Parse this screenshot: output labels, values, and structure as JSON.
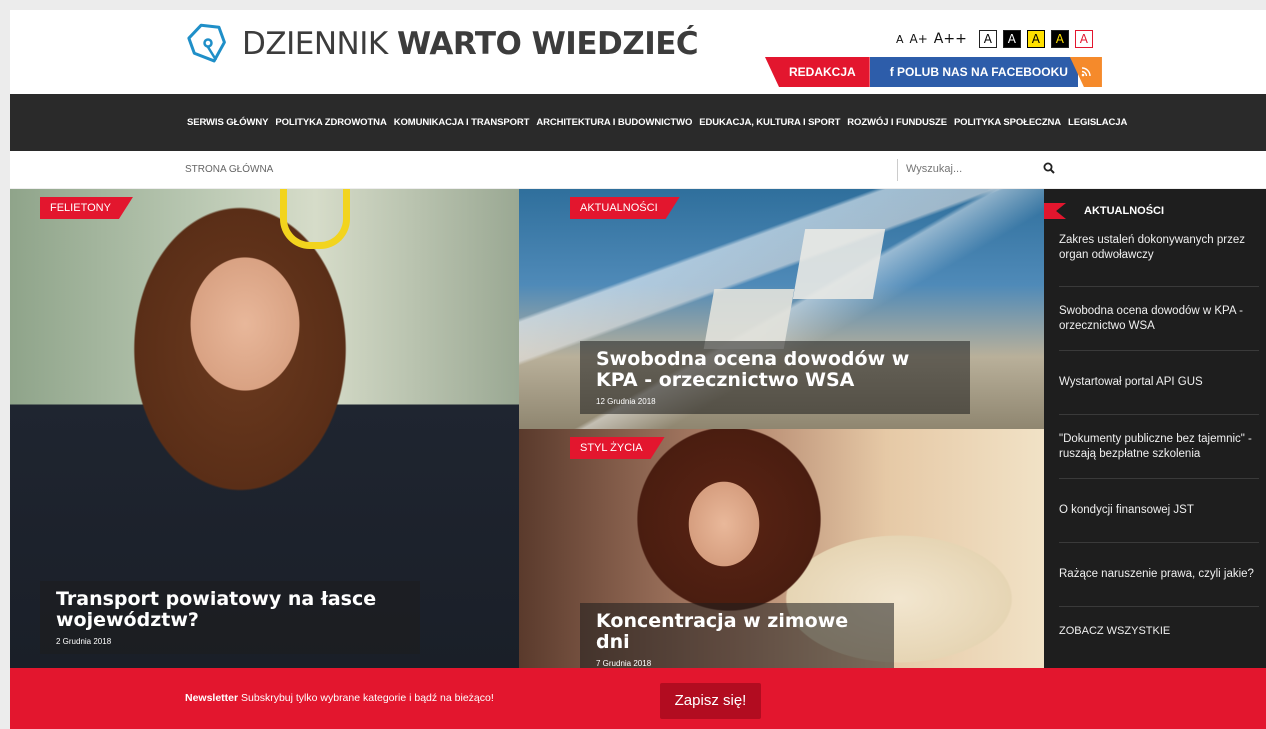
{
  "header": {
    "logo_light": "DZIENNIK ",
    "logo_bold": "WARTO WIEDZIEĆ",
    "font_sizes": [
      "A",
      "A+",
      "A++"
    ],
    "contrast_letter": "A",
    "redakcja": "REDAKCJA",
    "facebook": "f POLUB NAS NA FACEBOOKU",
    "rss": "))"
  },
  "nav": {
    "items": [
      "SERWIS GŁÓWNY",
      "POLITYKA ZDROWOTNA",
      "KOMUNIKACJA I TRANSPORT",
      "ARCHITEKTURA I BUDOWNICTWO",
      "EDUKACJA, KULTURA I SPORT",
      "ROZWÓJ I FUNDUSZE",
      "POLITYKA SPOŁECZNA",
      "LEGISLACJA"
    ]
  },
  "breadcrumb": "STRONA GŁÓWNA",
  "search": {
    "placeholder": "Wyszukaj..."
  },
  "tiles": {
    "a": {
      "tag": "FELIETONY",
      "title": "Transport powiatowy na łasce województw?",
      "date": "2 Grudnia 2018"
    },
    "b": {
      "tag": "AKTUALNOŚCI",
      "title": "Swobodna ocena dowodów w KPA - orzecznictwo WSA",
      "date": "12 Grudnia 2018"
    },
    "c": {
      "tag": "STYL ŻYCIA",
      "title": "Koncentracja w zimowe dni",
      "date": "7 Grudnia 2018"
    }
  },
  "sidebar": {
    "title": "AKTUALNOŚCI",
    "items": [
      "Zakres ustaleń dokonywanych przez organ odwoławczy",
      "Swobodna ocena dowodów w KPA - orzecznictwo WSA",
      "Wystartował portal API GUS",
      "\"Dokumenty publiczne bez tajemnic\" - ruszają bezpłatne szkolenia",
      "O kondycji finansowej JST",
      "Rażące naruszenie prawa, czyli jakie?"
    ],
    "see_all": "ZOBACZ WSZYSTKIE"
  },
  "newsletter": {
    "label": "Newsletter",
    "text": " Subskrybuj tylko wybrane kategorie i bądź na bieżąco!",
    "button": "Zapisz się!"
  },
  "colors": {
    "accent": "#e3162e",
    "dark": "#2a2a2a",
    "facebook": "#2d5daa",
    "rss": "#f58a2b"
  }
}
